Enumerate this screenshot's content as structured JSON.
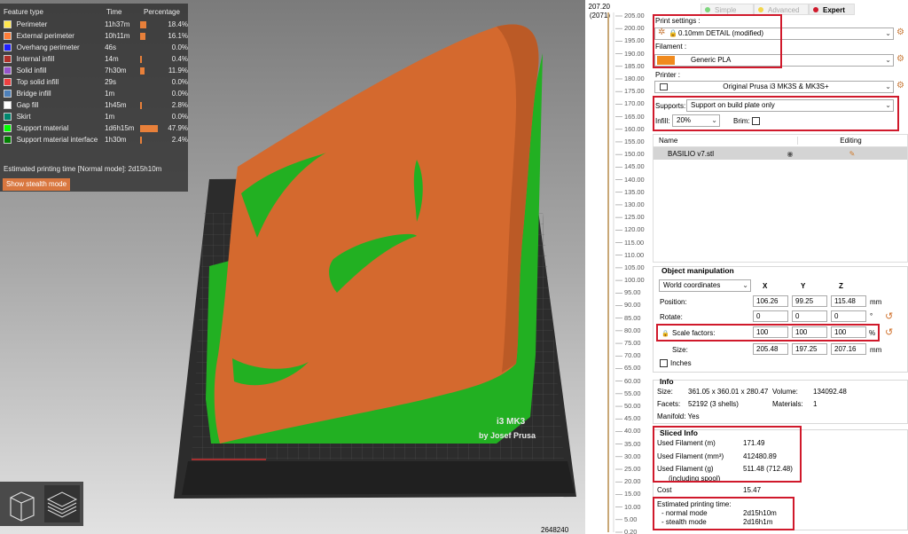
{
  "legend": {
    "headers": {
      "type": "Feature type",
      "time": "Time",
      "percentage": "Percentage"
    },
    "rows": [
      {
        "name": "Perimeter",
        "time": "11h37m",
        "percent": "18.4%",
        "fraction": 0.184,
        "color": "#ffe64d"
      },
      {
        "name": "External perimeter",
        "time": "10h11m",
        "percent": "16.1%",
        "fraction": 0.161,
        "color": "#ff7d38"
      },
      {
        "name": "Overhang perimeter",
        "time": "46s",
        "percent": "0.0%",
        "fraction": 0.0,
        "color": "#1f1fff"
      },
      {
        "name": "Internal infill",
        "time": "14m",
        "percent": "0.4%",
        "fraction": 0.004,
        "color": "#b03029"
      },
      {
        "name": "Solid infill",
        "time": "7h30m",
        "percent": "11.9%",
        "fraction": 0.119,
        "color": "#9654cc"
      },
      {
        "name": "Top solid infill",
        "time": "29s",
        "percent": "0.0%",
        "fraction": 0.0,
        "color": "#f04040"
      },
      {
        "name": "Bridge infill",
        "time": "1m",
        "percent": "0.0%",
        "fraction": 0.0,
        "color": "#4d80ba"
      },
      {
        "name": "Gap fill",
        "time": "1h45m",
        "percent": "2.8%",
        "fraction": 0.028,
        "color": "#ffffff"
      },
      {
        "name": "Skirt",
        "time": "1m",
        "percent": "0.0%",
        "fraction": 0.0,
        "color": "#00876e"
      },
      {
        "name": "Support material",
        "time": "1d6h15m",
        "percent": "47.9%",
        "fraction": 0.479,
        "color": "#00ff00"
      },
      {
        "name": "Support material interface",
        "time": "1h30m",
        "percent": "2.4%",
        "fraction": 0.024,
        "color": "#008000"
      }
    ],
    "estimated_time": "Estimated printing time [Normal mode]:  2d15h10m",
    "stealth_button": "Show stealth mode"
  },
  "bed": {
    "label_model": "i3 MK3",
    "label_brand": "by Josef Prusa"
  },
  "view_toggle": {
    "left_icon": "cube-icon",
    "right_icon": "layers-icon"
  },
  "layer_slider": {
    "top_value": "207.20",
    "top_layer": "(2071)",
    "bottom_value": "2648240",
    "ticks": [
      "205.00",
      "200.00",
      "195.00",
      "190.00",
      "185.00",
      "180.00",
      "175.00",
      "170.00",
      "165.00",
      "160.00",
      "155.00",
      "150.00",
      "145.00",
      "140.00",
      "135.00",
      "130.00",
      "125.00",
      "120.00",
      "115.00",
      "110.00",
      "105.00",
      "100.00",
      "95.00",
      "90.00",
      "85.00",
      "80.00",
      "75.00",
      "70.00",
      "65.00",
      "60.00",
      "55.00",
      "50.00",
      "45.00",
      "40.00",
      "35.00",
      "30.00",
      "25.00",
      "20.00",
      "15.00",
      "10.00",
      "5.00",
      "0.20"
    ]
  },
  "sidebar": {
    "modes": [
      {
        "label": "Simple",
        "color": "#7ed67e"
      },
      {
        "label": "Advanced",
        "color": "#f2d64b"
      },
      {
        "label": "Expert",
        "color": "#d0192b"
      }
    ],
    "print_settings_label": "Print settings :",
    "print_settings_value": "0.10mm DETAIL (modified)",
    "filament_label": "Filament :",
    "filament_value": "Generic PLA",
    "filament_color": "#f08a1e",
    "printer_label": "Printer :",
    "printer_value": "Original Prusa i3 MK3S & MK3S+",
    "supports_label": "Supports:",
    "supports_value": "Support on build plate only",
    "infill_label": "Infill:",
    "infill_value": "20%",
    "brim_label": "Brim:",
    "objects": {
      "col_name": "Name",
      "col_editing": "Editing",
      "rows": [
        {
          "name": "BASILIO v7.stl"
        }
      ]
    },
    "manipulation": {
      "title": "Object manipulation",
      "coord_system": "World coordinates",
      "axes": [
        "X",
        "Y",
        "Z"
      ],
      "position_label": "Position:",
      "position": [
        "106.26",
        "99.25",
        "115.48"
      ],
      "position_unit": "mm",
      "rotate_label": "Rotate:",
      "rotate": [
        "0",
        "0",
        "0"
      ],
      "rotate_unit": "°",
      "scale_label": "Scale factors:",
      "scale": [
        "100",
        "100",
        "100"
      ],
      "scale_unit": "%",
      "size_label": "Size:",
      "size": [
        "205.48",
        "197.25",
        "207.16"
      ],
      "size_unit": "mm",
      "inches_label": "Inches"
    },
    "info": {
      "title": "Info",
      "size_label": "Size:",
      "size_value": "361.05 x 360.01 x 280.47",
      "volume_label": "Volume:",
      "volume_value": "134092.48",
      "facets_label": "Facets:",
      "facets_value": "52192 (3 shells)",
      "materials_label": "Materials:",
      "materials_value": "1",
      "manifold": "Manifold: Yes"
    },
    "sliced": {
      "title": "Sliced Info",
      "rows": [
        {
          "label": "Used Filament (m)",
          "value": "171.49"
        },
        {
          "label": "Used Filament (mm³)",
          "value": "412480.89"
        },
        {
          "label": "Used Filament (g)",
          "value": "511.48 (712.48)"
        }
      ],
      "including_spool": "(including spool)",
      "cost_label": "Cost",
      "cost_value": "15.47",
      "est_title": "Estimated printing time:",
      "normal_label": "- normal mode",
      "normal_value": "2d15h10m",
      "stealth_label": "- stealth mode",
      "stealth_value": "2d16h1m"
    }
  }
}
